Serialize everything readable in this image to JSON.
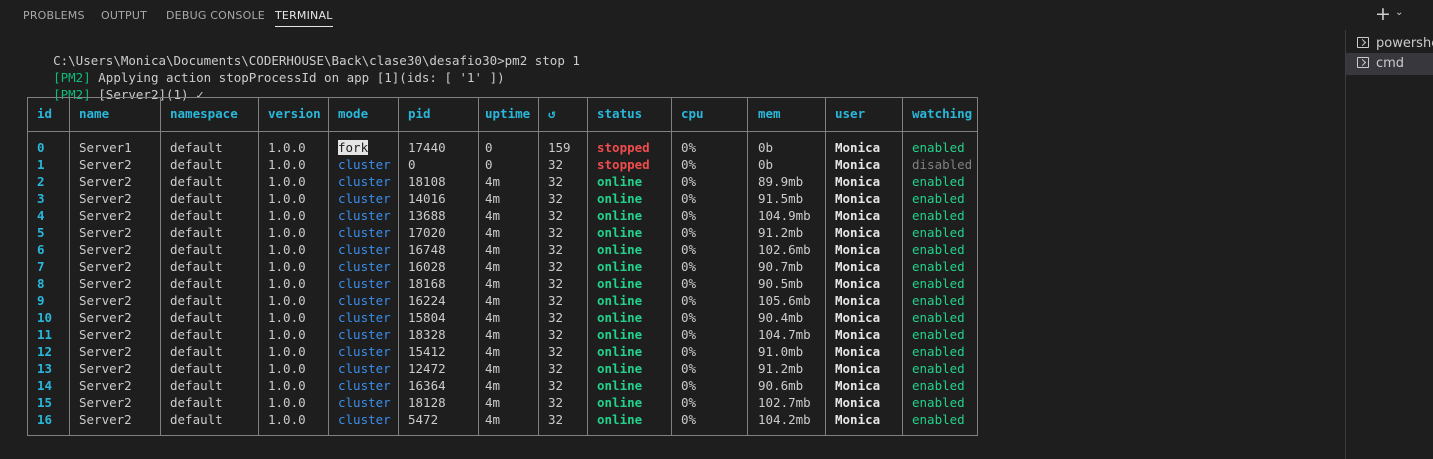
{
  "panel_tabs": [
    {
      "label": "PROBLEMS",
      "active": false
    },
    {
      "label": "OUTPUT",
      "active": false
    },
    {
      "label": "DEBUG CONSOLE",
      "active": false
    },
    {
      "label": "TERMINAL",
      "active": true
    }
  ],
  "toolbar": {
    "add_icon": "plus-icon",
    "menu_icon": "chevron-down-icon"
  },
  "terminal": {
    "lines": [
      {
        "prefix": "",
        "text": "C:\\Users\\Monica\\Documents\\CODERHOUSE\\Back\\clase30\\desafio30>pm2 stop 1"
      },
      {
        "prefix": "[PM2]",
        "text": " Applying action stopProcessId on app [1](ids: [ '1' ])"
      },
      {
        "prefix": "[PM2]",
        "text": " [Server2](1) ✓"
      }
    ],
    "table": {
      "headers": [
        "id",
        "name",
        "namespace",
        "version",
        "mode",
        "pid",
        "uptime",
        "↺",
        "status",
        "cpu",
        "mem",
        "user",
        "watching"
      ],
      "rows": [
        [
          "0",
          "Server1",
          "default",
          "1.0.0",
          "fork",
          "17440",
          "0",
          "159",
          "stopped",
          "0%",
          "0b",
          "Monica",
          "enabled"
        ],
        [
          "1",
          "Server2",
          "default",
          "1.0.0",
          "cluster",
          "0",
          "0",
          "32",
          "stopped",
          "0%",
          "0b",
          "Monica",
          "disabled"
        ],
        [
          "2",
          "Server2",
          "default",
          "1.0.0",
          "cluster",
          "18108",
          "4m",
          "32",
          "online",
          "0%",
          "89.9mb",
          "Monica",
          "enabled"
        ],
        [
          "3",
          "Server2",
          "default",
          "1.0.0",
          "cluster",
          "14016",
          "4m",
          "32",
          "online",
          "0%",
          "91.5mb",
          "Monica",
          "enabled"
        ],
        [
          "4",
          "Server2",
          "default",
          "1.0.0",
          "cluster",
          "13688",
          "4m",
          "32",
          "online",
          "0%",
          "104.9mb",
          "Monica",
          "enabled"
        ],
        [
          "5",
          "Server2",
          "default",
          "1.0.0",
          "cluster",
          "17020",
          "4m",
          "32",
          "online",
          "0%",
          "91.2mb",
          "Monica",
          "enabled"
        ],
        [
          "6",
          "Server2",
          "default",
          "1.0.0",
          "cluster",
          "16748",
          "4m",
          "32",
          "online",
          "0%",
          "102.6mb",
          "Monica",
          "enabled"
        ],
        [
          "7",
          "Server2",
          "default",
          "1.0.0",
          "cluster",
          "16028",
          "4m",
          "32",
          "online",
          "0%",
          "90.7mb",
          "Monica",
          "enabled"
        ],
        [
          "8",
          "Server2",
          "default",
          "1.0.0",
          "cluster",
          "18168",
          "4m",
          "32",
          "online",
          "0%",
          "90.5mb",
          "Monica",
          "enabled"
        ],
        [
          "9",
          "Server2",
          "default",
          "1.0.0",
          "cluster",
          "16224",
          "4m",
          "32",
          "online",
          "0%",
          "105.6mb",
          "Monica",
          "enabled"
        ],
        [
          "10",
          "Server2",
          "default",
          "1.0.0",
          "cluster",
          "15804",
          "4m",
          "32",
          "online",
          "0%",
          "90.4mb",
          "Monica",
          "enabled"
        ],
        [
          "11",
          "Server2",
          "default",
          "1.0.0",
          "cluster",
          "18328",
          "4m",
          "32",
          "online",
          "0%",
          "104.7mb",
          "Monica",
          "enabled"
        ],
        [
          "12",
          "Server2",
          "default",
          "1.0.0",
          "cluster",
          "15412",
          "4m",
          "32",
          "online",
          "0%",
          "91.0mb",
          "Monica",
          "enabled"
        ],
        [
          "13",
          "Server2",
          "default",
          "1.0.0",
          "cluster",
          "12472",
          "4m",
          "32",
          "online",
          "0%",
          "91.2mb",
          "Monica",
          "enabled"
        ],
        [
          "14",
          "Server2",
          "default",
          "1.0.0",
          "cluster",
          "16364",
          "4m",
          "32",
          "online",
          "0%",
          "90.6mb",
          "Monica",
          "enabled"
        ],
        [
          "15",
          "Server2",
          "default",
          "1.0.0",
          "cluster",
          "18128",
          "4m",
          "32",
          "online",
          "0%",
          "102.7mb",
          "Monica",
          "enabled"
        ],
        [
          "16",
          "Server2",
          "default",
          "1.0.0",
          "cluster",
          "5472",
          "4m",
          "32",
          "online",
          "0%",
          "104.2mb",
          "Monica",
          "enabled"
        ]
      ]
    }
  },
  "terminal_list": [
    {
      "label": "powershell",
      "icon": "powershell-icon",
      "selected": false
    },
    {
      "label": "cmd",
      "icon": "cmd-icon",
      "selected": true
    }
  ],
  "colors": {
    "background": "#1e1e1e",
    "header": "#29b8db",
    "cluster": "#3b8eea",
    "stopped": "#f14c4c",
    "online": "#23d18b",
    "disabled": "#808080"
  }
}
